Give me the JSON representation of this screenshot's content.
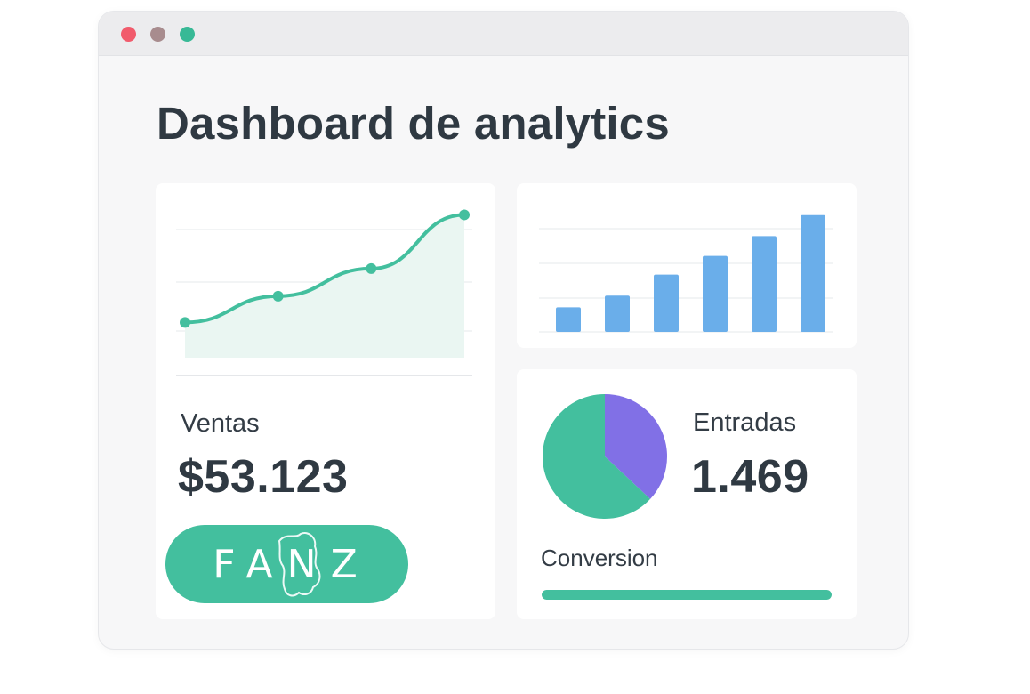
{
  "window": {
    "controls": [
      {
        "name": "close",
        "color": "#f15b6c"
      },
      {
        "name": "minimize",
        "color": "#a88c8e"
      },
      {
        "name": "maximize",
        "color": "#38b996"
      }
    ]
  },
  "page": {
    "title": "Dashboard de analytics"
  },
  "colors": {
    "accent": "#43bf9e",
    "bar": "#6aaeea",
    "purple": "#8170e6",
    "area": "#eaf6f2"
  },
  "sales_card": {
    "label": "Ventas",
    "value": "$53.123",
    "button_label": "FANZ",
    "chart_data": {
      "type": "line",
      "x": [
        1,
        2,
        3,
        4
      ],
      "values": [
        10,
        32,
        55,
        100
      ],
      "ylim": [
        -15,
        110
      ],
      "grid": true,
      "fill": "area"
    }
  },
  "bar_card": {
    "chart_data": {
      "type": "bar",
      "values": [
        21,
        31,
        49,
        65,
        82,
        100
      ],
      "ylim": [
        0,
        115
      ],
      "grid": true
    }
  },
  "entries_card": {
    "label": "Entradas",
    "value": "1.469",
    "pie_data": {
      "type": "pie",
      "slices": [
        {
          "value": 37,
          "color": "#8170e6"
        },
        {
          "value": 63,
          "color": "#43bf9e"
        }
      ]
    },
    "conversion_label": "Conversion",
    "conversion_progress": 1.0
  }
}
